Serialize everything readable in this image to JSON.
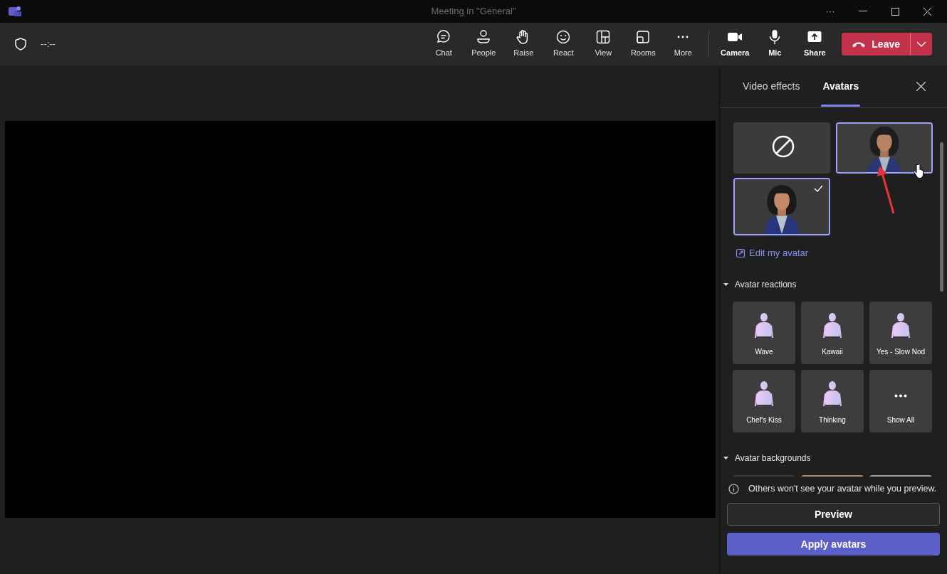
{
  "window": {
    "title": "Meeting in \"General\"",
    "more": "···"
  },
  "toolbar": {
    "timer": "--:--",
    "items": [
      {
        "kind": "chat",
        "label": "Chat"
      },
      {
        "kind": "people",
        "label": "People"
      },
      {
        "kind": "raise",
        "label": "Raise"
      },
      {
        "kind": "react",
        "label": "React"
      },
      {
        "kind": "view",
        "label": "View"
      },
      {
        "kind": "rooms",
        "label": "Rooms"
      },
      {
        "kind": "more",
        "label": "More"
      }
    ],
    "devices": [
      {
        "kind": "camera",
        "label": "Camera"
      },
      {
        "kind": "mic",
        "label": "Mic"
      },
      {
        "kind": "share",
        "label": "Share"
      }
    ],
    "leave": "Leave"
  },
  "panel": {
    "tabs": [
      {
        "label": "Video effects",
        "selected": false
      },
      {
        "label": "Avatars",
        "selected": true
      }
    ],
    "avatars": [
      {
        "kind": "none",
        "selected": false,
        "hovered": false
      },
      {
        "kind": "picture",
        "selected": false,
        "hovered": true
      },
      {
        "kind": "picture",
        "selected": true,
        "hovered": false
      }
    ],
    "edit_link": "Edit my avatar",
    "sections": [
      {
        "title": "Avatar reactions",
        "expanded": true,
        "items": [
          {
            "kind": "reaction",
            "label": "Wave"
          },
          {
            "kind": "reaction",
            "label": "Kawaii"
          },
          {
            "kind": "reaction",
            "label": "Yes - Slow Nod"
          },
          {
            "kind": "reaction",
            "label": "Chef's Kiss"
          },
          {
            "kind": "reaction",
            "label": "Thinking"
          },
          {
            "kind": "more",
            "label": "Show All"
          }
        ]
      },
      {
        "title": "Avatar backgrounds",
        "expanded": true,
        "items": [
          {
            "kind": "background",
            "color": "#3a3a3a"
          },
          {
            "kind": "background",
            "color": "#b88f6e"
          },
          {
            "kind": "background",
            "color": "#a8a2a0"
          }
        ]
      }
    ],
    "notice": "Others won't see your avatar while you preview.",
    "preview_button": "Preview",
    "apply_button": "Apply avatars"
  }
}
